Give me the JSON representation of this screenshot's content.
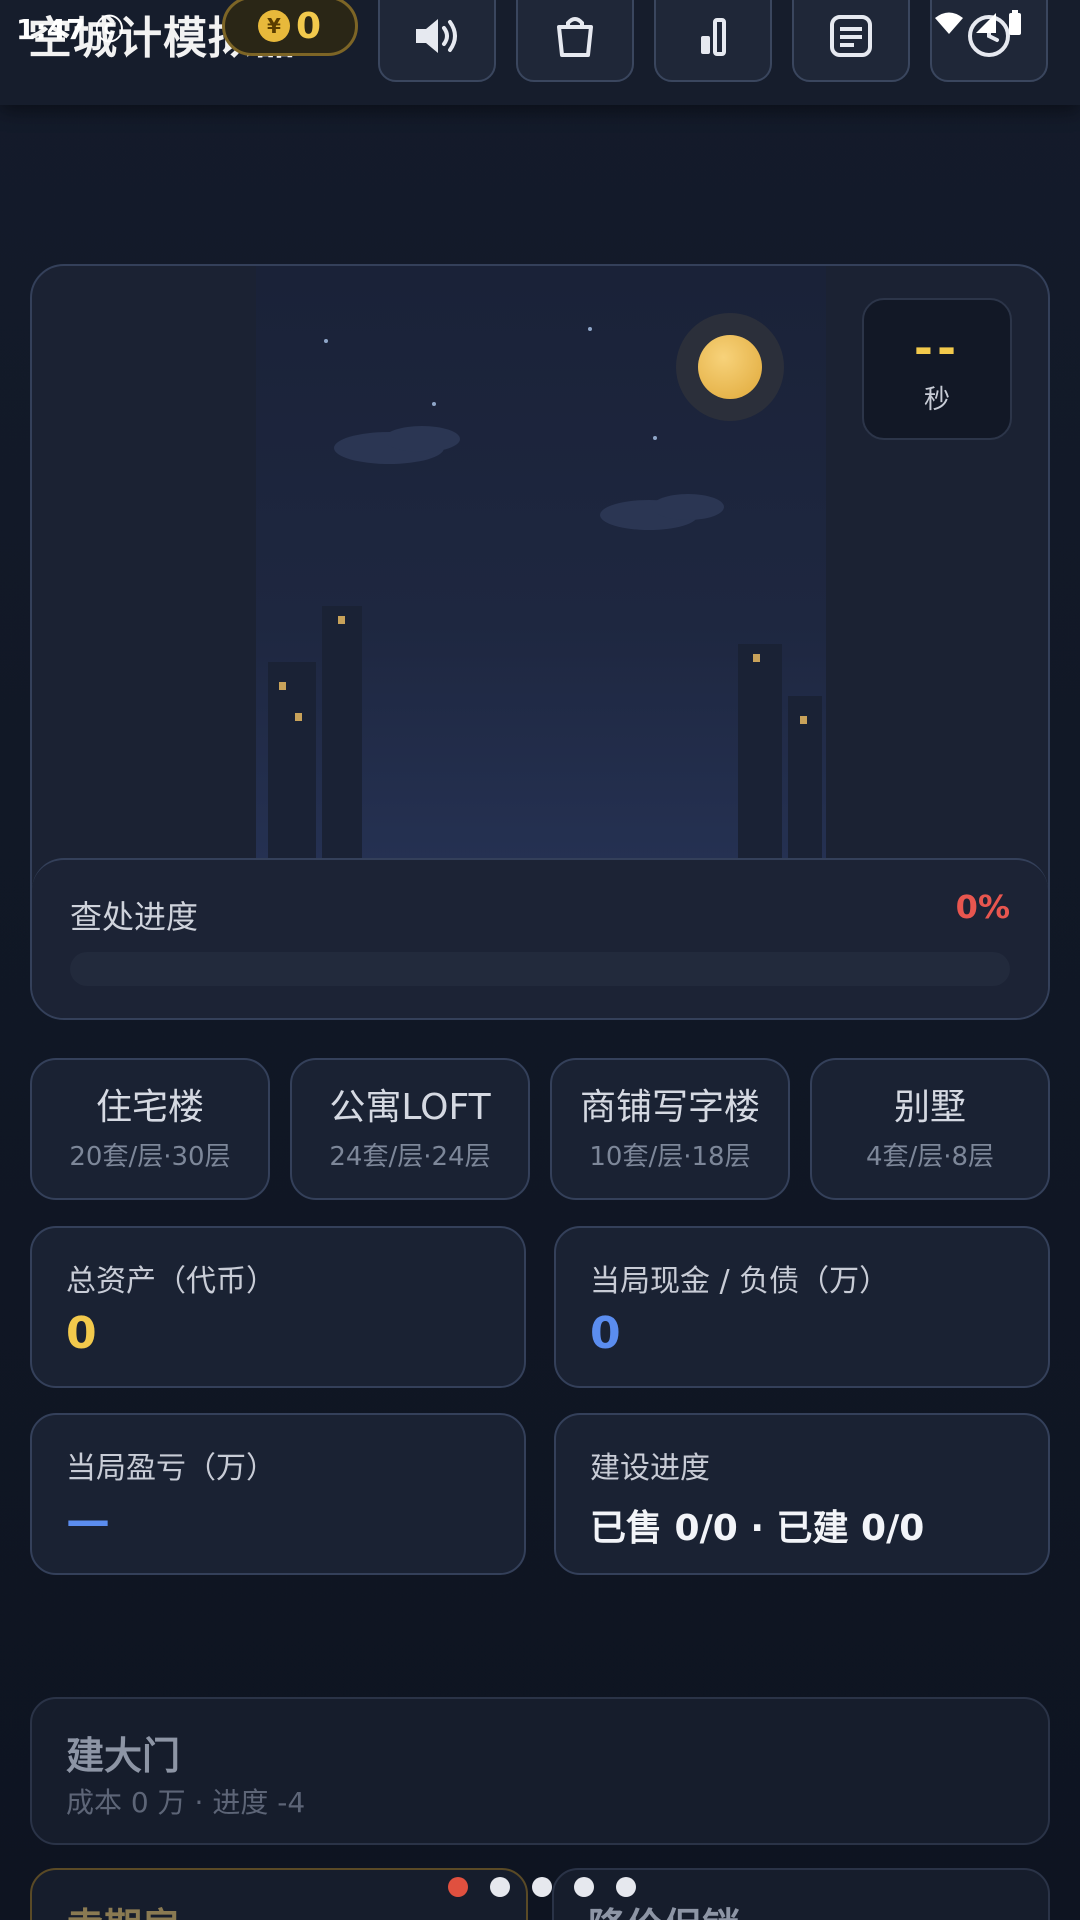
{
  "status_bar": {
    "time": "1:47 ⓒ"
  },
  "header": {
    "title": "空城计模拟器",
    "coin_symbol": "¥",
    "coin_value": "0",
    "toolbar": [
      {
        "name": "sound-button",
        "icon": "speaker-icon"
      },
      {
        "name": "shop-button",
        "icon": "shopping-bag-icon"
      },
      {
        "name": "stats-button",
        "icon": "bar-chart-icon"
      },
      {
        "name": "log-button",
        "icon": "document-icon"
      },
      {
        "name": "history-button",
        "icon": "clock-icon"
      }
    ]
  },
  "scene": {
    "timer_value": "--",
    "timer_unit": "秒",
    "progress_label": "查处进度",
    "progress_percent": "0%",
    "progress_fraction": 0
  },
  "building_types": [
    {
      "name": "住宅楼",
      "spec": "20套/层·30层"
    },
    {
      "name": "公寓LOFT",
      "spec": "24套/层·24层"
    },
    {
      "name": "商铺写字楼",
      "spec": "10套/层·18层"
    },
    {
      "name": "别墅",
      "spec": "4套/层·8层"
    }
  ],
  "stats": {
    "total_assets": {
      "label": "总资产（代币）",
      "value": "0"
    },
    "cash_debt": {
      "label": "当局现金 / 负债（万）",
      "value": "0"
    },
    "profit_loss": {
      "label": "当局盈亏（万）",
      "value": "—"
    },
    "build_progress": {
      "label": "建设进度",
      "value": "已售 0/0 · 已建 0/0"
    }
  },
  "actions": {
    "gate": {
      "title": "建大门",
      "sub": "成本 0 万 · 进度 -4"
    },
    "card_left_title": "卖期房",
    "card_right_title": "降价促销"
  },
  "pager": {
    "count": 5,
    "active": 0
  },
  "colors": {
    "accent_gold": "#f2c94c",
    "accent_blue": "#5b8def",
    "accent_red": "#e8564f"
  }
}
